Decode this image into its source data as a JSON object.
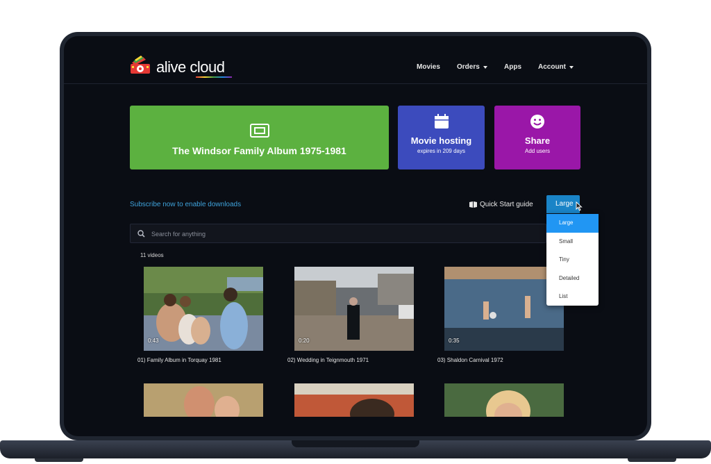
{
  "brand": {
    "name": "alive cloud"
  },
  "nav": {
    "items": [
      {
        "label": "Movies",
        "has_caret": false
      },
      {
        "label": "Orders",
        "has_caret": true
      },
      {
        "label": "Apps",
        "has_caret": false
      },
      {
        "label": "Account",
        "has_caret": true
      }
    ]
  },
  "cards": {
    "album": {
      "title": "The Windsor Family Album 1975-1981",
      "icon": "ticket-icon",
      "color": "#5cb140"
    },
    "hosting": {
      "title": "Movie hosting",
      "subtitle": "expires in 209 days",
      "icon": "calendar-icon",
      "color": "#3c4bbd"
    },
    "share": {
      "title": "Share",
      "subtitle": "Add users",
      "icon": "smiley-icon",
      "color": "#9a17a8"
    }
  },
  "toolbar": {
    "subscribe_link": "Subscribe now to enable downloads",
    "quick_start": "Quick Start guide",
    "size_selected": "Large"
  },
  "size_options": [
    "Large",
    "Small",
    "Tiny",
    "Detailed",
    "List"
  ],
  "search": {
    "placeholder": "Search for anything"
  },
  "video_count": "11 videos",
  "videos": [
    {
      "title": "01) Family Album in Torquay 1981",
      "duration": "0:43"
    },
    {
      "title": "02) Wedding in Teignmouth 1971",
      "duration": "0:20"
    },
    {
      "title": "03) Shaldon Carnival 1972",
      "duration": "0:35"
    }
  ],
  "colors": {
    "accent": "#1a84c7",
    "link": "#3fa3dc",
    "background": "#0a0d14"
  }
}
